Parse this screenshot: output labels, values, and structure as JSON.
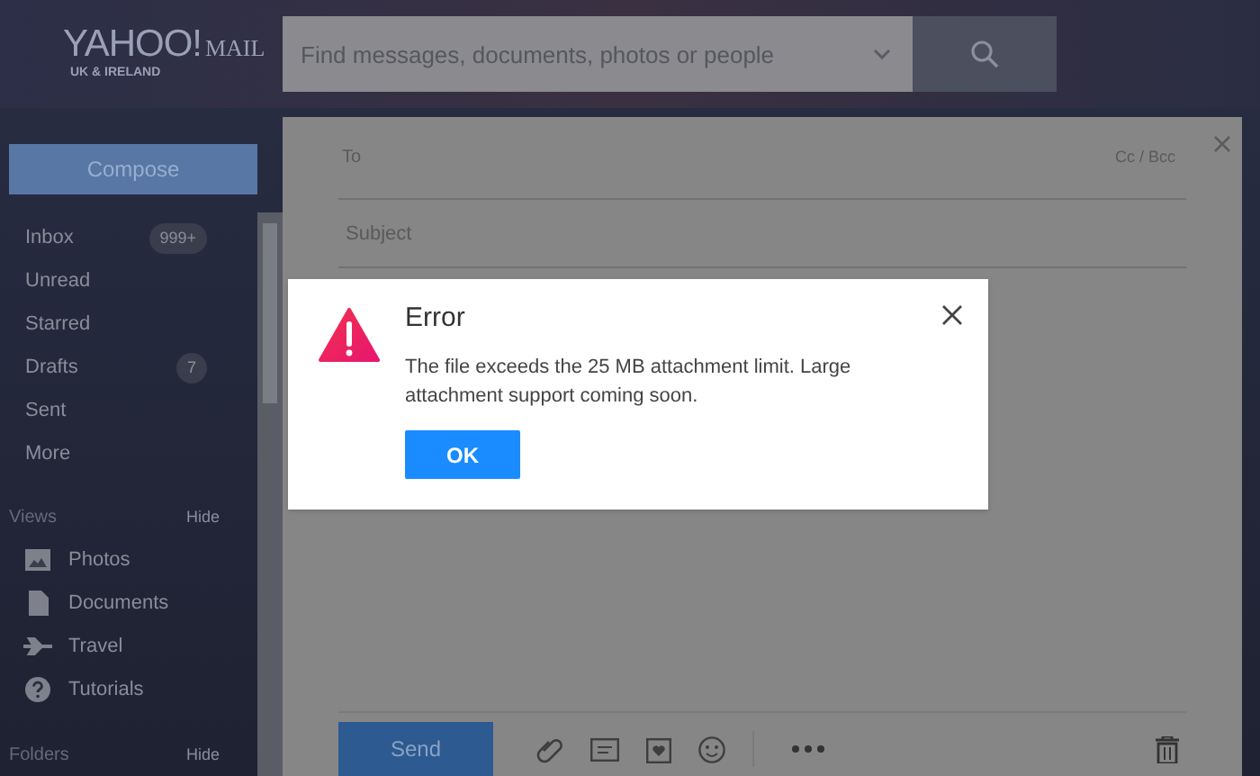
{
  "header": {
    "logo": "YAHOO!",
    "logo_product": "MAIL",
    "logo_region": "UK & IRELAND",
    "search": {
      "placeholder": "Find messages, documents, photos or people"
    }
  },
  "sidebar": {
    "compose": "Compose",
    "folders": [
      {
        "label": "Inbox",
        "badge": "999+"
      },
      {
        "label": "Unread"
      },
      {
        "label": "Starred"
      },
      {
        "label": "Drafts",
        "badge": "7"
      },
      {
        "label": "Sent"
      },
      {
        "label": "More"
      }
    ],
    "views": {
      "title": "Views",
      "toggle": "Hide",
      "items": [
        {
          "label": "Photos",
          "kind": "photos"
        },
        {
          "label": "Documents",
          "kind": "documents"
        },
        {
          "label": "Travel",
          "kind": "travel"
        },
        {
          "label": "Tutorials",
          "kind": "tutorials"
        }
      ]
    },
    "folders_section": {
      "title": "Folders",
      "toggle": "Hide"
    }
  },
  "compose": {
    "to_label": "To",
    "cc_bcc": "Cc / Bcc",
    "subject_placeholder": "Subject",
    "send": "Send"
  },
  "dialog": {
    "title": "Error",
    "message": "The file exceeds the 25 MB attachment limit. Large attachment support coming soon.",
    "button": "OK"
  }
}
